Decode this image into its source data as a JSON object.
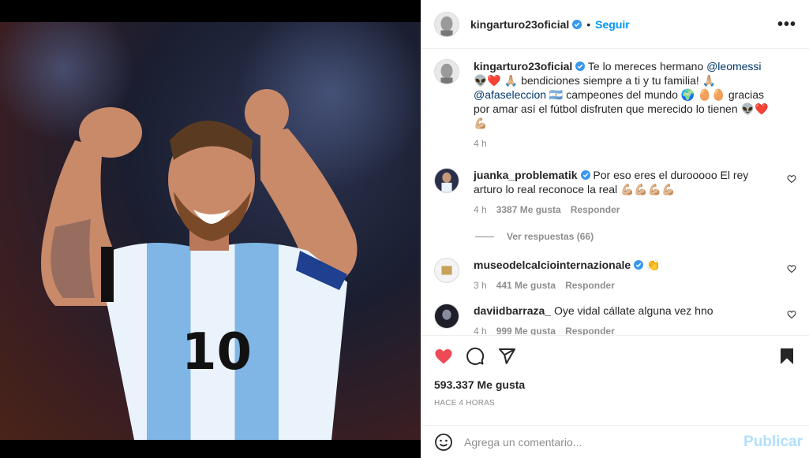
{
  "post": {
    "author": "kingarturo23oficial",
    "follow_label": "Seguir",
    "dot": "•",
    "more_label": "•••"
  },
  "caption": {
    "author": "kingarturo23oficial",
    "text_1": "Te lo mereces hermano ",
    "mention_1": "@leomessi",
    "emoji_1": "👽❤️",
    "text_2": "🙏🏼 bendiciones siempre a ti y tu familia! 🙏🏼 ",
    "mention_2": "@afaseleccion",
    "text_3": " 🇦🇷 campeones del mundo 🌍 🥚🥚 gracias por amar así el fútbol disfruten que merecido lo tienen 👽❤️💪🏼",
    "time": "4 h"
  },
  "comments": [
    {
      "author": "juanka_problematik",
      "text": "Por eso eres el durooooo El rey arturo lo real reconoce la real 💪🏼💪🏼💪🏼💪🏼",
      "time": "4 h",
      "likes": "3387 Me gusta",
      "reply": "Responder"
    },
    {
      "author": "museodelcalciointernazionale",
      "text": "👏",
      "time": "3 h",
      "likes": "441 Me gusta",
      "reply": "Responder"
    },
    {
      "author": "daviidbarraza_",
      "text": "Oye vidal cállate alguna vez hno",
      "time": "4 h",
      "likes": "999 Me gusta",
      "reply": "Responder"
    }
  ],
  "view_replies": "Ver respuestas (66)",
  "footer": {
    "likes": "593.337 Me gusta",
    "ago": "HACE 4 HORAS",
    "comment_placeholder": "Agrega un comentario...",
    "post_label": "Publicar"
  },
  "icons": {
    "like": "heart-filled-icon",
    "comment": "comment-icon",
    "share": "paper-plane-icon",
    "save": "bookmark-filled-icon",
    "emoji": "smiley-icon"
  },
  "colors": {
    "like_red": "#ed4956",
    "link_blue": "#0095f6",
    "verified_blue": "#3897f0",
    "mention_blue": "#00376b"
  }
}
